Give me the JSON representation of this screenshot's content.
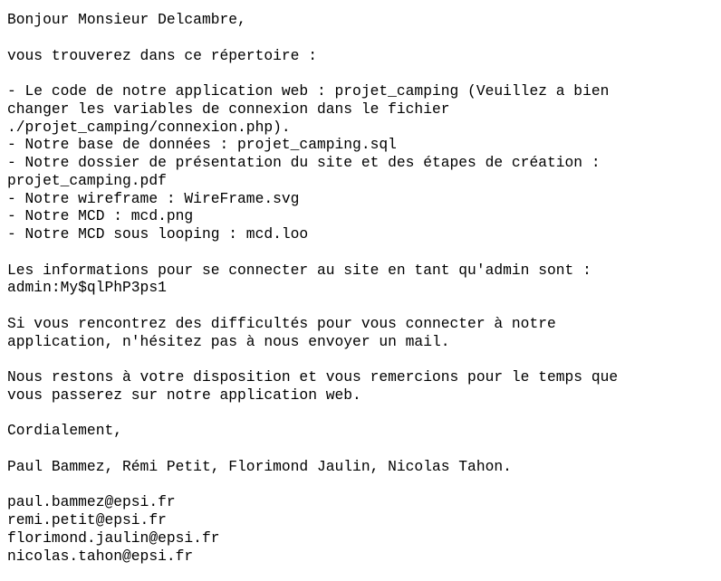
{
  "document": {
    "greeting": "Bonjour Monsieur Delcambre,",
    "intro": "vous trouverez dans ce répertoire :",
    "items": [
      "- Le code de notre application web : projet_camping (Veuillez a bien",
      "changer les variables de connexion dans le fichier",
      "./projet_camping/connexion.php).",
      "- Notre base de données : projet_camping.sql",
      "- Notre dossier de présentation du site et des étapes de création :",
      "projet_camping.pdf",
      "- Notre wireframe : WireFrame.svg",
      "- Notre MCD : mcd.png",
      "- Notre MCD sous looping : mcd.loo"
    ],
    "admin_info": [
      "Les informations pour se connecter au site en tant qu'admin sont :",
      "admin:My$qlPhP3ps1"
    ],
    "difficulties": [
      "Si vous rencontrez des difficultés pour vous connecter à notre",
      "application, n'hésitez pas à nous envoyer un mail."
    ],
    "thanks": [
      "Nous restons à votre disposition et vous remercions pour le temps que",
      "vous passerez sur notre application web."
    ],
    "closing": "Cordialement,",
    "signature": "Paul Bammez, Rémi Petit, Florimond Jaulin, Nicolas Tahon.",
    "emails": [
      "paul.bammez@epsi.fr",
      "remi.petit@epsi.fr",
      "florimond.jaulin@epsi.fr",
      "nicolas.tahon@epsi.fr"
    ]
  }
}
